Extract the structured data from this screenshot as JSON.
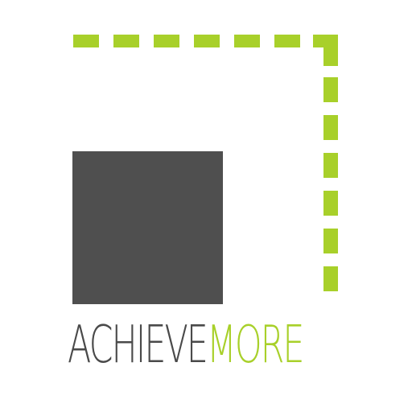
{
  "brand": {
    "name_part_1": "ACHIEVE",
    "name_part_2": "MORE",
    "colors": {
      "dark": "#4f4f4f",
      "accent": "#a8d02a",
      "text_dark": "#4a4a4a",
      "background": "#ffffff"
    },
    "mark": {
      "shape": "solid square with dashed corner bracket",
      "square_icon": "solid-square-icon",
      "bracket_icon": "dashed-corner-bracket-icon"
    }
  }
}
